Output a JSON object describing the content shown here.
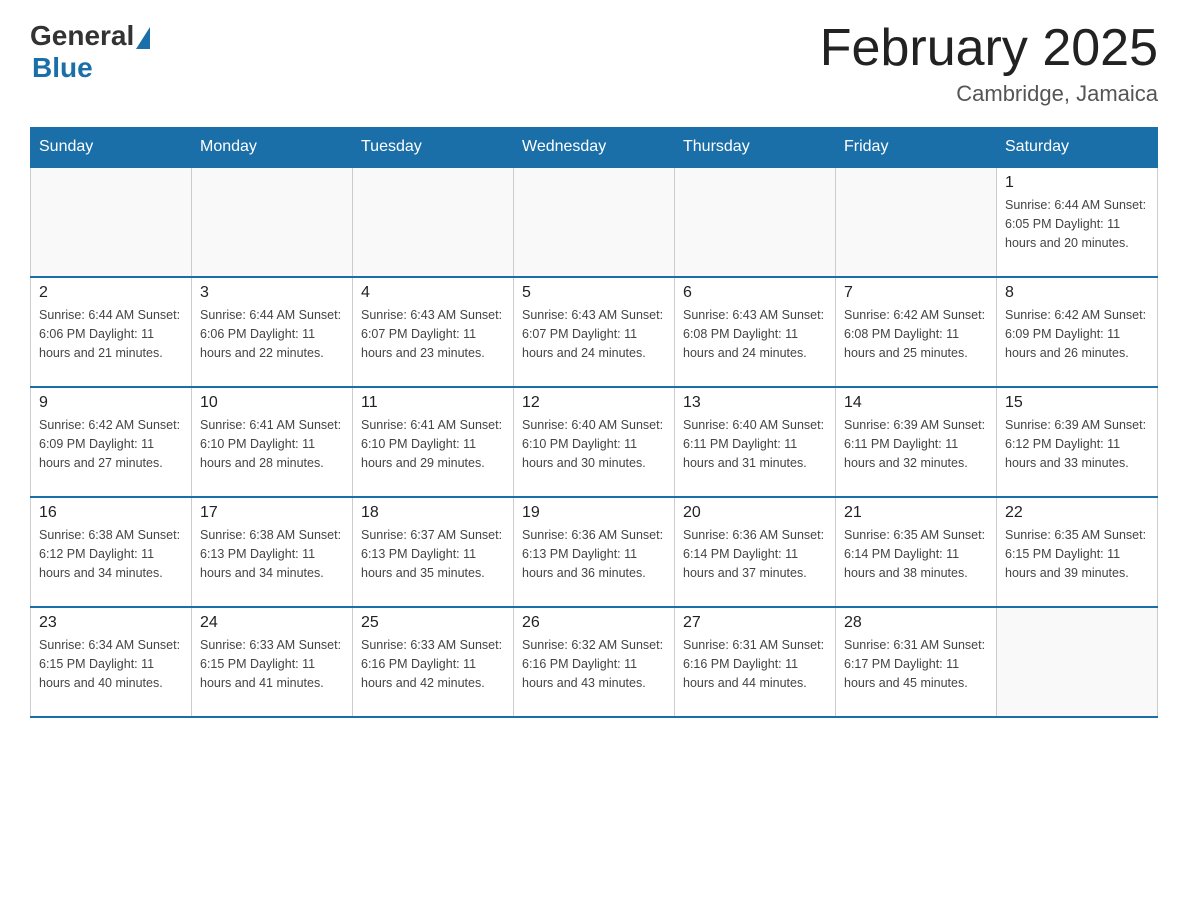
{
  "logo": {
    "general": "General",
    "blue": "Blue"
  },
  "header": {
    "title": "February 2025",
    "subtitle": "Cambridge, Jamaica"
  },
  "weekdays": [
    "Sunday",
    "Monday",
    "Tuesday",
    "Wednesday",
    "Thursday",
    "Friday",
    "Saturday"
  ],
  "weeks": [
    [
      {
        "day": "",
        "info": ""
      },
      {
        "day": "",
        "info": ""
      },
      {
        "day": "",
        "info": ""
      },
      {
        "day": "",
        "info": ""
      },
      {
        "day": "",
        "info": ""
      },
      {
        "day": "",
        "info": ""
      },
      {
        "day": "1",
        "info": "Sunrise: 6:44 AM\nSunset: 6:05 PM\nDaylight: 11 hours\nand 20 minutes."
      }
    ],
    [
      {
        "day": "2",
        "info": "Sunrise: 6:44 AM\nSunset: 6:06 PM\nDaylight: 11 hours\nand 21 minutes."
      },
      {
        "day": "3",
        "info": "Sunrise: 6:44 AM\nSunset: 6:06 PM\nDaylight: 11 hours\nand 22 minutes."
      },
      {
        "day": "4",
        "info": "Sunrise: 6:43 AM\nSunset: 6:07 PM\nDaylight: 11 hours\nand 23 minutes."
      },
      {
        "day": "5",
        "info": "Sunrise: 6:43 AM\nSunset: 6:07 PM\nDaylight: 11 hours\nand 24 minutes."
      },
      {
        "day": "6",
        "info": "Sunrise: 6:43 AM\nSunset: 6:08 PM\nDaylight: 11 hours\nand 24 minutes."
      },
      {
        "day": "7",
        "info": "Sunrise: 6:42 AM\nSunset: 6:08 PM\nDaylight: 11 hours\nand 25 minutes."
      },
      {
        "day": "8",
        "info": "Sunrise: 6:42 AM\nSunset: 6:09 PM\nDaylight: 11 hours\nand 26 minutes."
      }
    ],
    [
      {
        "day": "9",
        "info": "Sunrise: 6:42 AM\nSunset: 6:09 PM\nDaylight: 11 hours\nand 27 minutes."
      },
      {
        "day": "10",
        "info": "Sunrise: 6:41 AM\nSunset: 6:10 PM\nDaylight: 11 hours\nand 28 minutes."
      },
      {
        "day": "11",
        "info": "Sunrise: 6:41 AM\nSunset: 6:10 PM\nDaylight: 11 hours\nand 29 minutes."
      },
      {
        "day": "12",
        "info": "Sunrise: 6:40 AM\nSunset: 6:10 PM\nDaylight: 11 hours\nand 30 minutes."
      },
      {
        "day": "13",
        "info": "Sunrise: 6:40 AM\nSunset: 6:11 PM\nDaylight: 11 hours\nand 31 minutes."
      },
      {
        "day": "14",
        "info": "Sunrise: 6:39 AM\nSunset: 6:11 PM\nDaylight: 11 hours\nand 32 minutes."
      },
      {
        "day": "15",
        "info": "Sunrise: 6:39 AM\nSunset: 6:12 PM\nDaylight: 11 hours\nand 33 minutes."
      }
    ],
    [
      {
        "day": "16",
        "info": "Sunrise: 6:38 AM\nSunset: 6:12 PM\nDaylight: 11 hours\nand 34 minutes."
      },
      {
        "day": "17",
        "info": "Sunrise: 6:38 AM\nSunset: 6:13 PM\nDaylight: 11 hours\nand 34 minutes."
      },
      {
        "day": "18",
        "info": "Sunrise: 6:37 AM\nSunset: 6:13 PM\nDaylight: 11 hours\nand 35 minutes."
      },
      {
        "day": "19",
        "info": "Sunrise: 6:36 AM\nSunset: 6:13 PM\nDaylight: 11 hours\nand 36 minutes."
      },
      {
        "day": "20",
        "info": "Sunrise: 6:36 AM\nSunset: 6:14 PM\nDaylight: 11 hours\nand 37 minutes."
      },
      {
        "day": "21",
        "info": "Sunrise: 6:35 AM\nSunset: 6:14 PM\nDaylight: 11 hours\nand 38 minutes."
      },
      {
        "day": "22",
        "info": "Sunrise: 6:35 AM\nSunset: 6:15 PM\nDaylight: 11 hours\nand 39 minutes."
      }
    ],
    [
      {
        "day": "23",
        "info": "Sunrise: 6:34 AM\nSunset: 6:15 PM\nDaylight: 11 hours\nand 40 minutes."
      },
      {
        "day": "24",
        "info": "Sunrise: 6:33 AM\nSunset: 6:15 PM\nDaylight: 11 hours\nand 41 minutes."
      },
      {
        "day": "25",
        "info": "Sunrise: 6:33 AM\nSunset: 6:16 PM\nDaylight: 11 hours\nand 42 minutes."
      },
      {
        "day": "26",
        "info": "Sunrise: 6:32 AM\nSunset: 6:16 PM\nDaylight: 11 hours\nand 43 minutes."
      },
      {
        "day": "27",
        "info": "Sunrise: 6:31 AM\nSunset: 6:16 PM\nDaylight: 11 hours\nand 44 minutes."
      },
      {
        "day": "28",
        "info": "Sunrise: 6:31 AM\nSunset: 6:17 PM\nDaylight: 11 hours\nand 45 minutes."
      },
      {
        "day": "",
        "info": ""
      }
    ]
  ]
}
